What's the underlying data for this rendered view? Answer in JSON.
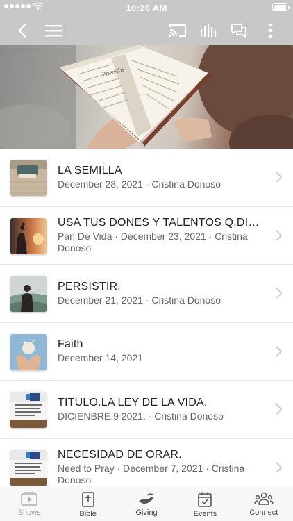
{
  "status_bar": {
    "time": "10:26 AM"
  },
  "header": {
    "back_icon": "chevron-left-icon",
    "menu_icon": "hamburger-icon",
    "cast_icon": "cast-icon",
    "audio_icon": "audio-bars-icon",
    "chat_icon": "chat-bubbles-icon",
    "more_icon": "more-vertical-icon"
  },
  "hero": {
    "image": "woman-reading-bible-photo",
    "book_caption": "Proverbs"
  },
  "items": [
    {
      "title": "LA SEMILLA",
      "subtitle": "December 28, 2021 · Cristina Donoso",
      "thumb": "typewriter-thumbnail"
    },
    {
      "title": "USA TUS DONES Y TALENTOS Q.DIO...",
      "subtitle": "Pan De Vida · December 23, 2021 · Cristina Donoso",
      "thumb": "sunset-person-thumbnail"
    },
    {
      "title": "PERSISTIR.",
      "subtitle": "December 21, 2021 · Cristina Donoso",
      "thumb": "hiker-thumbnail"
    },
    {
      "title": "Faith",
      "subtitle": "December 14, 2021",
      "thumb": "cupped-hands-thumbnail"
    },
    {
      "title": "TITULO.LA LEY DE LA VIDA.",
      "subtitle": "DICIENBRE.9 2021. · Cristina Donoso",
      "thumb": "radio-flyer-thumbnail"
    },
    {
      "title": "NECESIDAD DE ORAR.",
      "subtitle": "Need to Pray · December 7, 2021 · Cristina Donoso",
      "thumb": "radio-flyer-thumbnail"
    }
  ],
  "tabs": [
    {
      "label": "Shows",
      "icon": "play-screen-icon",
      "active": true
    },
    {
      "label": "Bible",
      "icon": "bible-icon",
      "active": false
    },
    {
      "label": "Giving",
      "icon": "giving-hand-icon",
      "active": false
    },
    {
      "label": "Events",
      "icon": "calendar-icon",
      "active": false
    },
    {
      "label": "Connect",
      "icon": "people-icon",
      "active": false
    }
  ]
}
